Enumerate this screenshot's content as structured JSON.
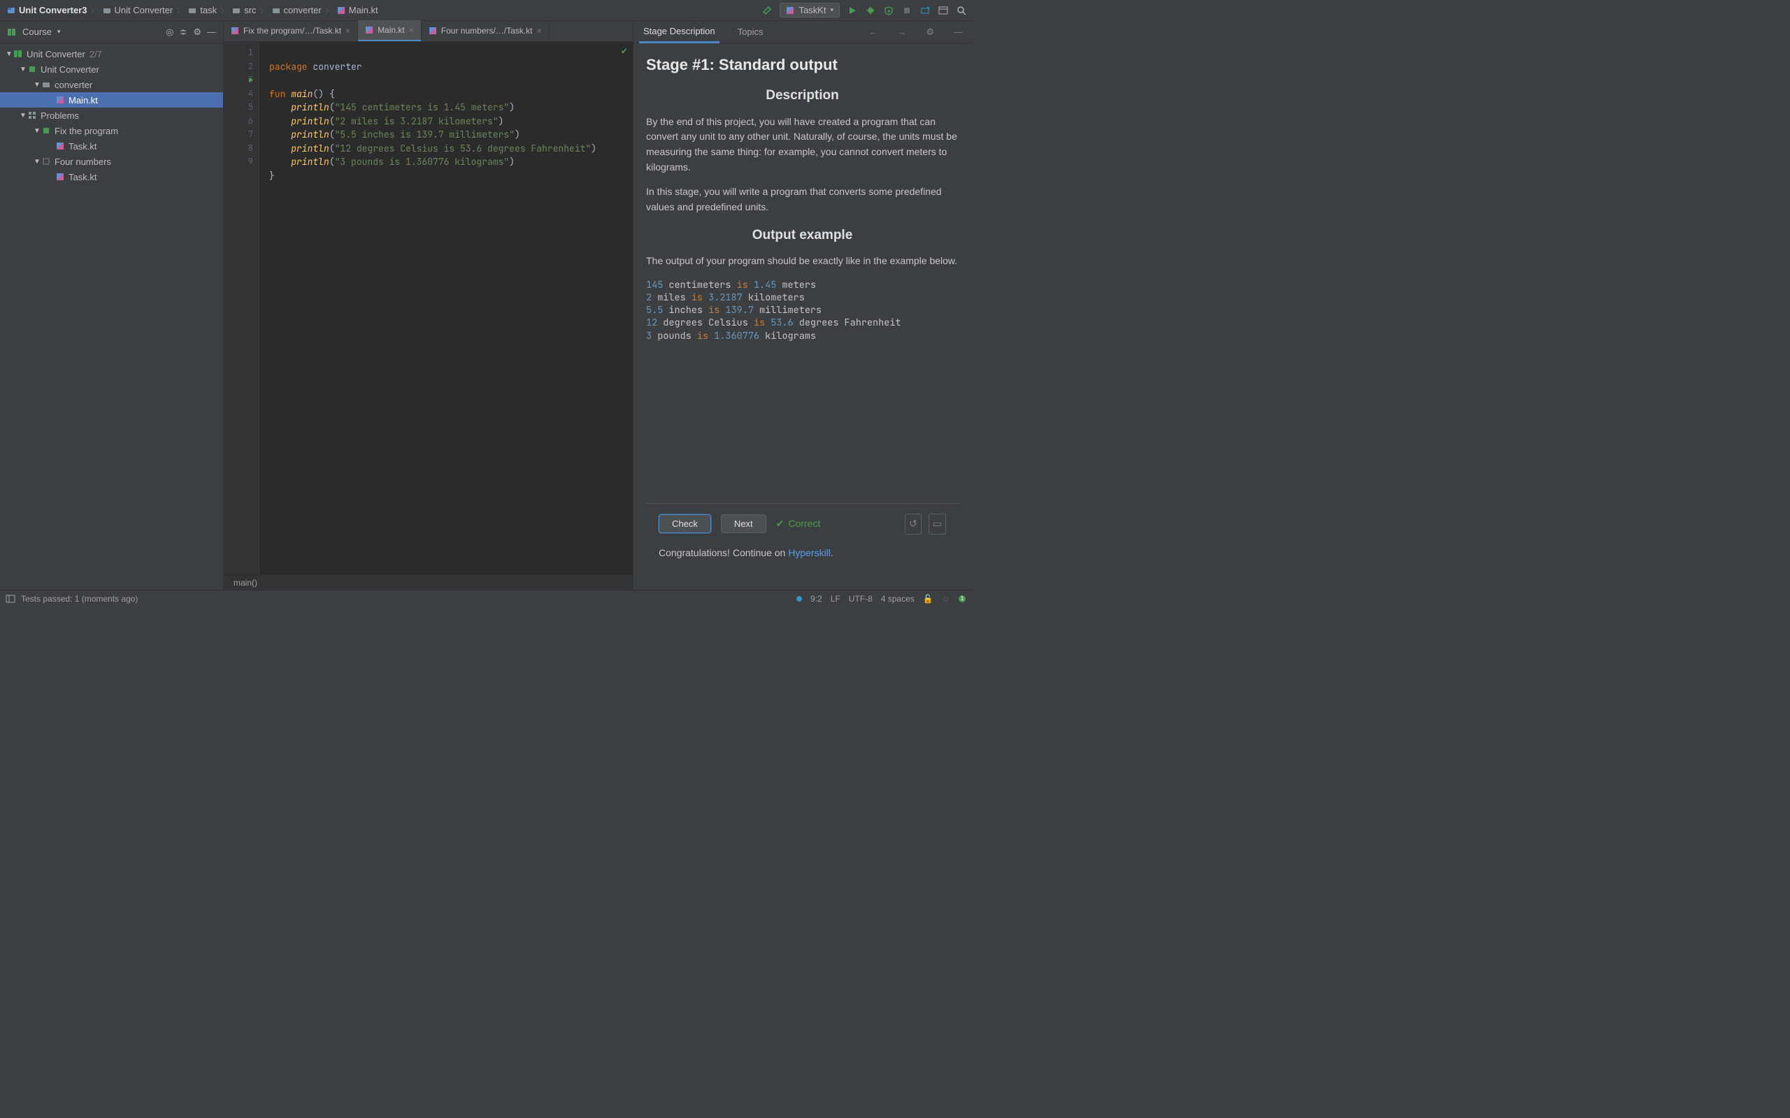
{
  "breadcrumb": [
    {
      "label": "Unit Converter3",
      "icon": "project"
    },
    {
      "label": "Unit Converter",
      "icon": "folder"
    },
    {
      "label": "task",
      "icon": "folder"
    },
    {
      "label": "src",
      "icon": "folder"
    },
    {
      "label": "converter",
      "icon": "folder"
    },
    {
      "label": "Main.kt",
      "icon": "kotlin"
    }
  ],
  "run_config": "TaskKt",
  "course_panel": {
    "title": "Course",
    "tree": [
      {
        "depth": 0,
        "expand": true,
        "icon": "book",
        "label": "Unit Converter",
        "suffix": "2/7"
      },
      {
        "depth": 1,
        "expand": true,
        "icon": "square-green",
        "label": "Unit Converter"
      },
      {
        "depth": 2,
        "expand": true,
        "icon": "folder",
        "label": "converter"
      },
      {
        "depth": 3,
        "icon": "kotlin",
        "label": "Main.kt",
        "selected": true
      },
      {
        "depth": 1,
        "expand": true,
        "icon": "grid",
        "label": "Problems"
      },
      {
        "depth": 2,
        "expand": true,
        "icon": "square-green",
        "label": "Fix the program"
      },
      {
        "depth": 3,
        "icon": "kotlin",
        "label": "Task.kt"
      },
      {
        "depth": 2,
        "expand": true,
        "icon": "square-outline",
        "label": "Four numbers"
      },
      {
        "depth": 3,
        "icon": "kotlin",
        "label": "Task.kt"
      }
    ]
  },
  "editor_tabs": [
    {
      "label": "Fix the program/…/Task.kt"
    },
    {
      "label": "Main.kt",
      "active": true
    },
    {
      "label": "Four numbers/…/Task.kt"
    }
  ],
  "code": {
    "lines": [
      "1",
      "2",
      "3",
      "4",
      "5",
      "6",
      "7",
      "8",
      "9"
    ],
    "package_kw": "package",
    "package_name": " converter",
    "fun_kw": "fun ",
    "main_name": "main",
    "paren": "() ",
    "lbrace": "{",
    "println": "println",
    "paren_open": "(",
    "paren_close": ")",
    "s1": "\"145 centimeters is 1.45 meters\"",
    "s2": "\"2 miles is 3.2187 kilometers\"",
    "s3": "\"5.5 inches is 139.7 millimeters\"",
    "s4": "\"12 degrees Celsius is 53.6 degrees Fahrenheit\"",
    "s5": "\"3 pounds is 1.360776 kilograms\"",
    "rbrace": "}"
  },
  "breadcrumb_bottom": "main()",
  "desc_panel": {
    "tabs": [
      {
        "label": "Stage Description",
        "active": true
      },
      {
        "label": "Topics"
      }
    ],
    "title": "Stage #1: Standard output",
    "h_description": "Description",
    "p1": "By the end of this project, you will have created a program that can convert any unit to any other unit. Naturally, of course, the units must be measuring the same thing: for example, you cannot convert meters to kilograms.",
    "p2": "In this stage, you will write a program that converts some predefined values and predefined units.",
    "h_output": "Output example",
    "p3": "The output of your program should be exactly like in the example below.",
    "example": [
      {
        "n": "145",
        "t1": " centimeters ",
        "k": "is",
        "t2": " ",
        "n2": "1.45",
        "t3": " meters"
      },
      {
        "n": "2",
        "t1": " miles ",
        "k": "is",
        "t2": " ",
        "n2": "3.2187",
        "t3": " kilometers"
      },
      {
        "n": "5.5",
        "t1": " inches ",
        "k": "is",
        "t2": " ",
        "n2": "139.7",
        "t3": " millimeters"
      },
      {
        "n": "12",
        "t1": " degrees Celsius ",
        "k": "is",
        "t2": " ",
        "n2": "53.6",
        "t3": " degrees Fahrenheit"
      },
      {
        "n": "3",
        "t1": " pounds ",
        "k": "is",
        "t2": " ",
        "n2": "1.360776",
        "t3": " kilograms"
      }
    ],
    "check_btn": "Check",
    "next_btn": "Next",
    "correct": "Correct",
    "congrats_pre": "Congratulations! Continue on ",
    "congrats_link": "Hyperskill",
    "congrats_post": "."
  },
  "statusbar": {
    "tests": "Tests passed: 1 (moments ago)",
    "pos": "9:2",
    "lf": "LF",
    "enc": "UTF-8",
    "indent": "4 spaces",
    "notif": "1"
  }
}
